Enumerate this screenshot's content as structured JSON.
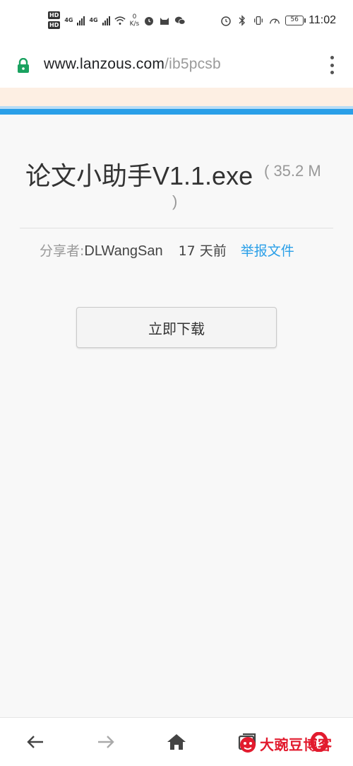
{
  "status_bar": {
    "hd_1": "HD",
    "hd_2": "HD",
    "net_1": "4G",
    "net_2": "4G",
    "speed_value": "0",
    "speed_unit": "K/s",
    "battery": "56",
    "time": "11:02"
  },
  "address_bar": {
    "host": "www.lanzous.com",
    "path": "/ib5pcsb"
  },
  "file": {
    "name": "论文小助手V1.1.exe",
    "size_open": "( 35.2 M",
    "size_close": ")"
  },
  "meta": {
    "sharer_label": "分享者:",
    "sharer": "DLWangSan",
    "time": "17 天前",
    "report": "举报文件"
  },
  "download": {
    "label": "立即下载"
  },
  "watermark": {
    "text": "大豌豆博客"
  },
  "colors": {
    "accent_blue": "#2a9fe8",
    "lock_green": "#1aa260",
    "watermark_red": "#e21b2e"
  }
}
